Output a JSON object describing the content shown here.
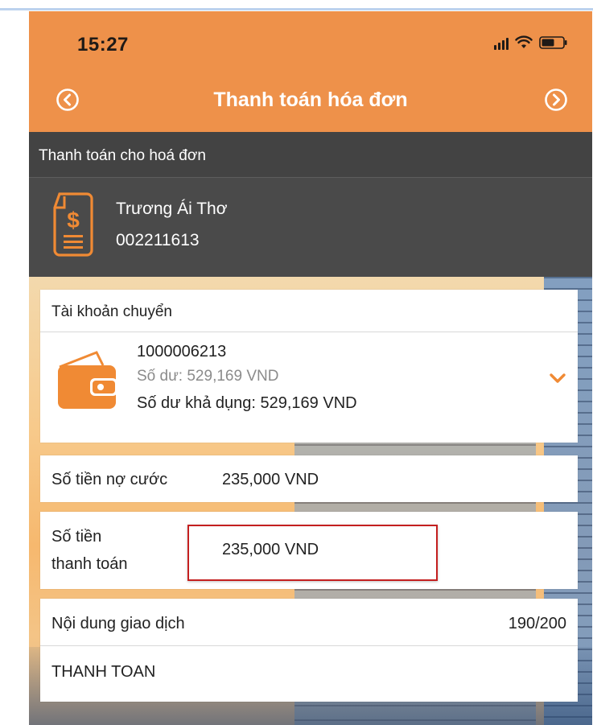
{
  "status_bar": {
    "time": "15:27",
    "signal_icon": "signal-icon",
    "wifi_icon": "wifi-icon",
    "battery_icon": "battery-icon"
  },
  "header": {
    "title": "Thanh toán hóa đơn",
    "back_icon": "back-circle-icon",
    "forward_icon": "forward-circle-icon",
    "background_color": "#ee914a"
  },
  "bill": {
    "section_title": "Thanh toán cho hoá đơn",
    "icon": "bill-dollar-icon",
    "customer_name": "Trương Ái Thơ",
    "customer_code": "002211613"
  },
  "source_account": {
    "title": "Tài khoản chuyển",
    "icon": "wallet-icon",
    "account_number": "1000006213",
    "balance": "Số dư: 529,169 VND",
    "available_balance": "Số dư khả dụng: 529,169 VND",
    "dropdown_icon": "chevron-down-icon"
  },
  "amount_due": {
    "label": "Số tiền nợ cước",
    "value": "235,000 VND"
  },
  "payment_amount": {
    "label_line1": "Số tiền",
    "label_line2": "thanh toán",
    "value": "235,000 VND",
    "highlight_color": "#c41f1f"
  },
  "transaction_content": {
    "label": "Nội dung giao dịch",
    "counter": "190/200",
    "value": "THANH TOAN"
  },
  "colors": {
    "accent": "#ee914a",
    "dark_panel": "#4a4a4a"
  }
}
